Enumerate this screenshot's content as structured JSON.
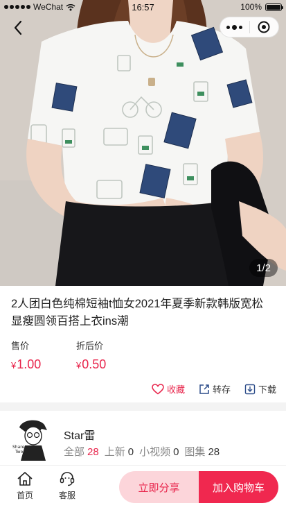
{
  "status_bar": {
    "carrier": "WeChat",
    "time": "16:57",
    "battery": "100%"
  },
  "gallery": {
    "page_indicator": "1/2"
  },
  "product": {
    "title": "2人团白色纯棉短袖t恤女2021年夏季新款韩版宽松显瘦圆领百搭上衣ins潮",
    "sale_label": "售价",
    "sale_currency": "¥",
    "sale_price": "1.00",
    "discount_label": "折后价",
    "discount_currency": "¥",
    "discount_price": "0.50",
    "actions": {
      "favorite": "收藏",
      "forward": "转存",
      "download": "下载"
    }
  },
  "shop": {
    "name": "Star雷",
    "avatar_text": "Share Two",
    "stats": [
      {
        "label": "全部",
        "value": "28"
      },
      {
        "label": "上新",
        "value": "0"
      },
      {
        "label": "小视频",
        "value": "0"
      },
      {
        "label": "图集",
        "value": "28"
      }
    ]
  },
  "bottom_bar": {
    "home": "首页",
    "service": "客服",
    "share_button": "立即分享",
    "cart_button": "加入购物车"
  },
  "colors": {
    "accent": "#e8244b",
    "share_bg": "#fcd5da",
    "cart_bg": "#f0284f"
  }
}
